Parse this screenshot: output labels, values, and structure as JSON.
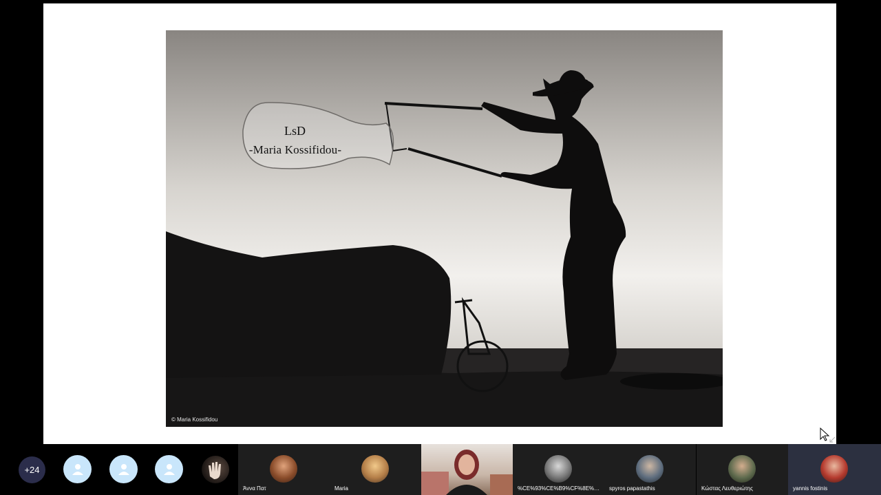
{
  "slide": {
    "watermark": {
      "monogram": "LsD",
      "name": "-Maria Kossifidou-"
    },
    "copyright": "© Maria Kossifidou"
  },
  "participants": {
    "more_count": "+24",
    "tiles": [
      {
        "name": "Άννα Πατ"
      },
      {
        "name": "Maria"
      },
      {
        "name": ""
      },
      {
        "name": "%CE%93%CE%B9%CF%8E%CF%81..."
      },
      {
        "name": "spyros papastathis"
      },
      {
        "name": "Κώστας Λευθεριώτης"
      },
      {
        "name": "yannis fostinis"
      }
    ]
  },
  "colors": {
    "strip_bg": "#000000",
    "tile_bg": "#1e1e1e",
    "active_tile_bg": "#2c3040",
    "badge_bg": "#2b2d4b",
    "anon_avatar_bg": "#c9e6fb"
  },
  "icons": [
    "person-icon",
    "cursor-icon",
    "collapse-icon"
  ]
}
